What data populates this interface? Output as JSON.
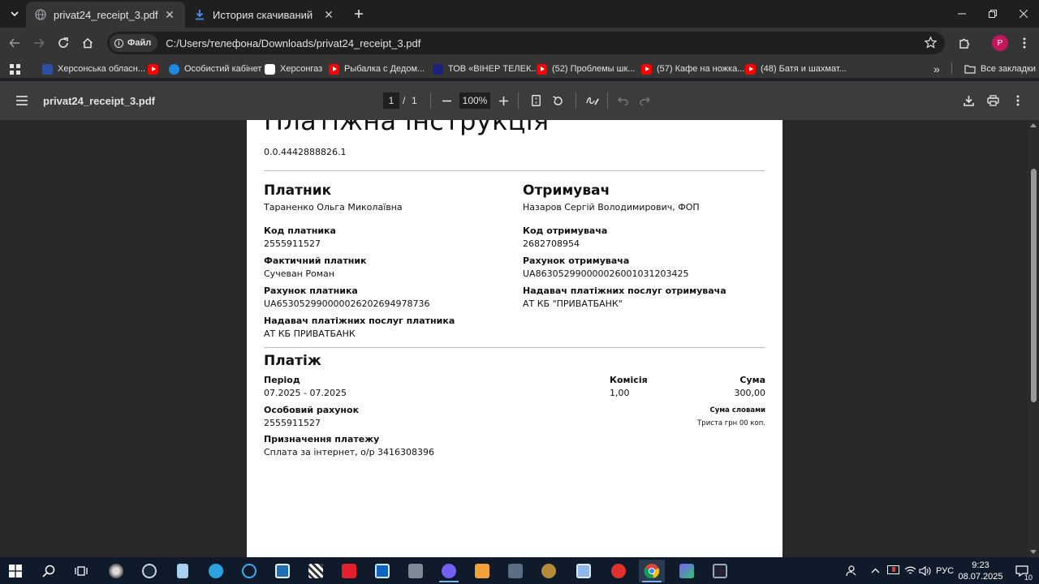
{
  "browser": {
    "tabs": [
      {
        "title": "privat24_receipt_3.pdf",
        "active": true,
        "icon": "globe-icon"
      },
      {
        "title": "История скачиваний",
        "active": false,
        "icon": "download-icon"
      }
    ],
    "address": {
      "chip_label": "Файл",
      "url": "C:/Users/телефона/Downloads/privat24_receipt_3.pdf"
    },
    "profile_initial": "P",
    "bookmarks": [
      {
        "label": "Херсонська обласн...",
        "icon": "site-icon"
      },
      {
        "label": "",
        "icon": "youtube-icon"
      },
      {
        "label": "Особистий кабінет",
        "icon": "site-icon"
      },
      {
        "label": "Херсонгаз",
        "icon": "site-icon"
      },
      {
        "label": "Рыбалка с Дедом...",
        "icon": "youtube-icon"
      },
      {
        "label": "ТОВ «ВІНЕР ТЕЛЕК...",
        "icon": "site-icon"
      },
      {
        "label": "(52) Проблемы шк...",
        "icon": "youtube-icon"
      },
      {
        "label": "(57) Кафе на ножка...",
        "icon": "youtube-icon"
      },
      {
        "label": "(48) Батя и шахмат...",
        "icon": "youtube-icon"
      }
    ],
    "bookmarks_overflow": "»",
    "all_bookmarks": "Все закладки"
  },
  "pdf_toolbar": {
    "file_name": "privat24_receipt_3.pdf",
    "current_page": "1",
    "page_separator": "/",
    "total_pages": "1",
    "zoom": "100%"
  },
  "document": {
    "title": "Платіжна інструкція",
    "doc_number": "0.0.4442888826.1",
    "payer": {
      "heading": "Платник",
      "name": "Тараненко Ольга Миколаївна",
      "code_label": "Код платника",
      "code": "2555911527",
      "actual_payer_label": "Фактичний платник",
      "actual_payer": "Сучеван Роман",
      "account_label": "Рахунок платника",
      "account": "UA653052990000026202694978736",
      "provider_label": "Надавач платіжних послуг платника",
      "provider": "АТ КБ ПРИВАТБАНК"
    },
    "recipient": {
      "heading": "Отримувач",
      "name": "Назаров Сергій Володимирович, ФОП",
      "code_label": "Код отримувача",
      "code": "2682708954",
      "account_label": "Рахунок отримувача",
      "account": "UA863052990000026001031203425",
      "provider_label": "Надавач платіжних послуг отримувача",
      "provider": "АТ КБ \"ПРИВАТБАНК\""
    },
    "payment": {
      "heading": "Платіж",
      "period_label": "Період",
      "period": "07.2025 - 07.2025",
      "fee_label": "Комісія",
      "fee": "1,00",
      "sum_label": "Сума",
      "sum": "300,00",
      "personal_account_label": "Особовий рахунок",
      "personal_account": "2555911527",
      "sum_words_label": "Сума словами",
      "sum_words": "Триста грн 00 коп.",
      "purpose_label": "Призначення платежу",
      "purpose": "Сплата за інтернет, о/р 3416308396"
    }
  },
  "taskbar": {
    "language": "РУС",
    "time": "9:23",
    "date": "08.07.2025",
    "notification_count": "10"
  },
  "colors": {
    "youtube": "#ff0000",
    "profile": "#c2185b",
    "taskbar": "#0f1b2a"
  }
}
